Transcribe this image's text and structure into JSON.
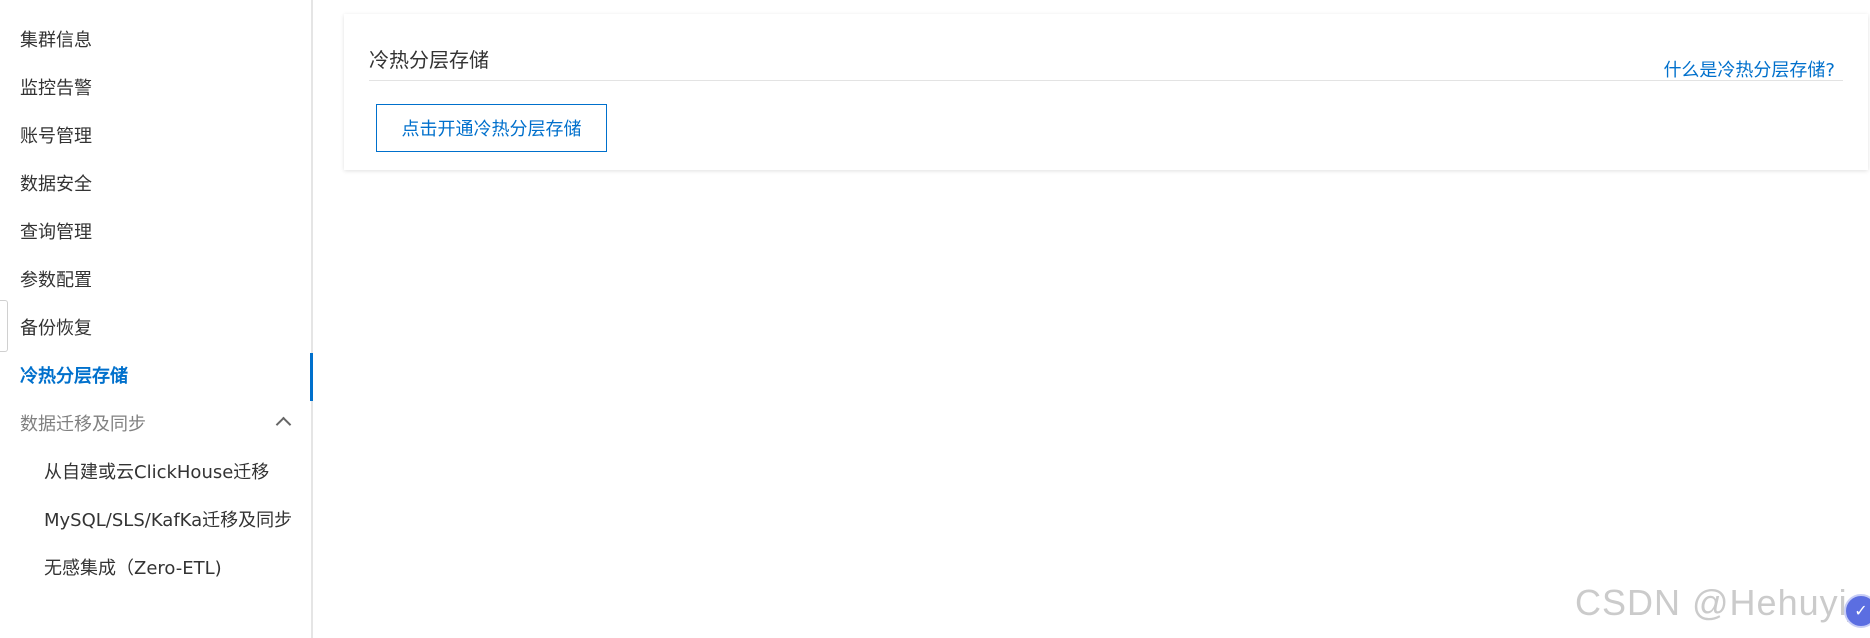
{
  "sidebar": {
    "items": [
      {
        "label": "集群信息"
      },
      {
        "label": "监控告警"
      },
      {
        "label": "账号管理"
      },
      {
        "label": "数据安全"
      },
      {
        "label": "查询管理"
      },
      {
        "label": "参数配置"
      },
      {
        "label": "备份恢复"
      },
      {
        "label": "冷热分层存储",
        "active": true
      },
      {
        "label": "数据迁移及同步",
        "expanded": true
      }
    ],
    "sub_items": [
      {
        "label": "从自建或云ClickHouse迁移"
      },
      {
        "label": "MySQL/SLS/KafKa迁移及同步"
      },
      {
        "label": "无感集成（Zero-ETL)"
      }
    ]
  },
  "main": {
    "title": "冷热分层存储",
    "help_link": "什么是冷热分层存储?",
    "enable_button": "点击开通冷热分层存储"
  },
  "watermark": "CSDN @Hehuyi_In",
  "colors": {
    "accent": "#0070cc",
    "text": "#333333",
    "muted": "#808080"
  }
}
